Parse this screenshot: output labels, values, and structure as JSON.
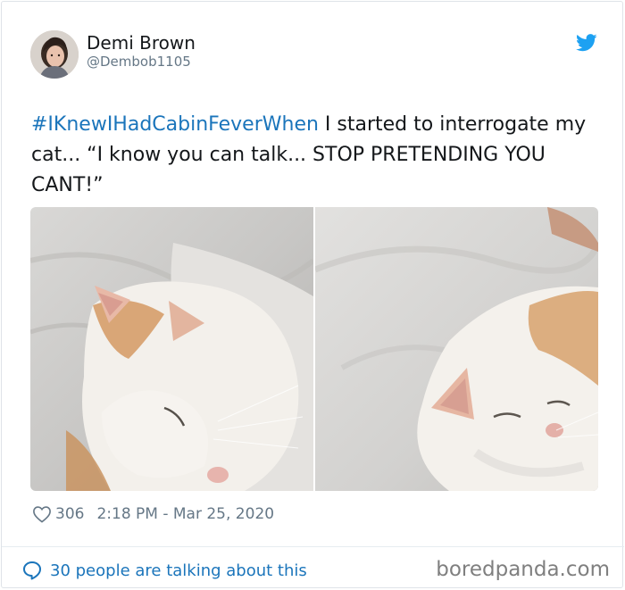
{
  "tweet": {
    "author_name": "Demi Brown",
    "author_handle": "@Dembob1105",
    "hashtag": "#IKnewIHadCabinFeverWhen",
    "body": " I started to interrogate my cat... “I know you can talk... STOP PRETENDING YOU CANT!”",
    "like_count": "306",
    "timestamp": "2:18 PM - Mar 25, 2020",
    "conversation": "30 people are talking about this"
  },
  "footer": {
    "watermark": "boredpanda.com"
  },
  "icons": {
    "brand": "twitter-bird-icon",
    "like": "heart-icon",
    "reply": "speech-bubble-icon"
  },
  "colors": {
    "link": "#1b75bb",
    "twitter_blue": "#1da1f2",
    "secondary_text": "#657786"
  }
}
